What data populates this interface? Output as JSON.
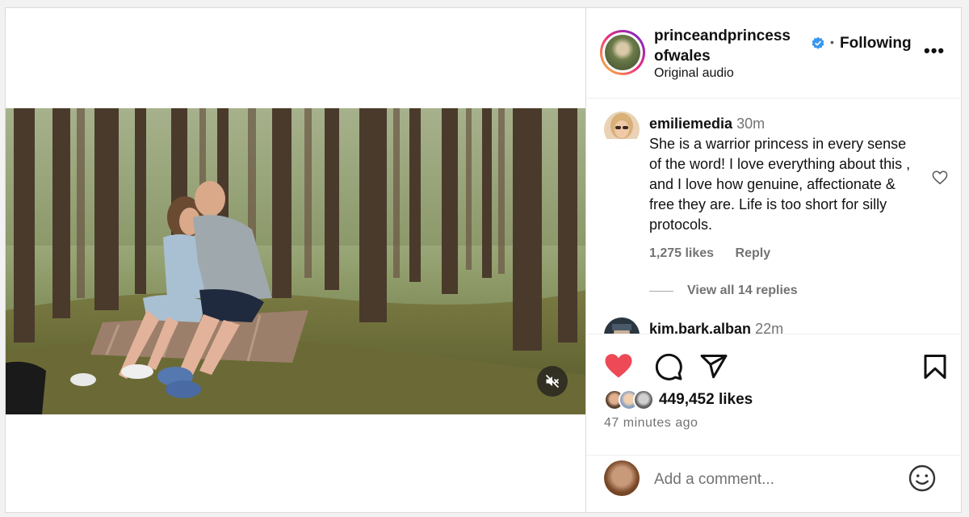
{
  "post": {
    "username": "princeandprincessofwales",
    "username_line1": "princeandprincess",
    "username_line2": "ofwales",
    "follow_status": "Following",
    "audio": "Original audio",
    "more": "•••",
    "likes": "449,452 likes",
    "time_ago": "47 minutes ago"
  },
  "comments": [
    {
      "user": "emiliemedia",
      "time": "30m",
      "text": "She is a warrior princess in every sense of the word! I love everything about this , and I love how genuine, affectionate & free they are. Life is too short for silly protocols.",
      "likes": "1,275 likes",
      "reply_label": "Reply",
      "view_replies": "View all 14 replies"
    },
    {
      "user": "kim.bark.alban",
      "time": "22m"
    }
  ],
  "comment_box": {
    "placeholder": "Add a comment..."
  },
  "colors": {
    "like_red": "#ed4956",
    "verified_blue": "#3897f0",
    "muted_text": "#737373"
  },
  "icons": [
    "heart-icon",
    "comment-icon",
    "share-icon",
    "bookmark-icon",
    "mute-icon",
    "verified-icon",
    "emoji-icon",
    "more-icon"
  ]
}
